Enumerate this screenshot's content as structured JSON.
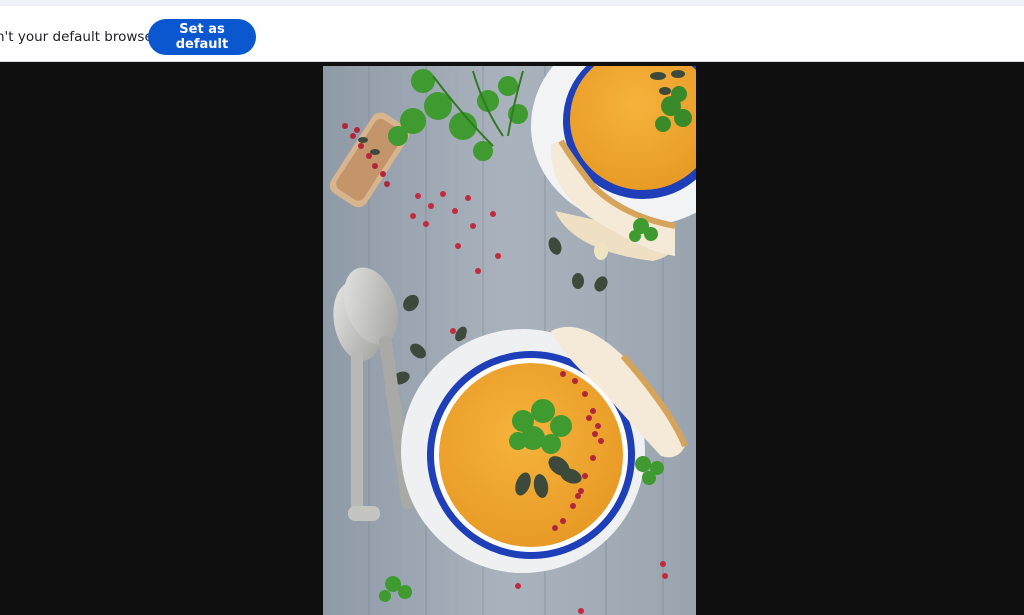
{
  "infobar": {
    "message": "n't your default browser",
    "button_label": "Set as default"
  },
  "viewer": {
    "image_subject": "soup-bowls-photo"
  },
  "colors": {
    "button": "#0b57d0",
    "background": "#0f0f10",
    "infobar": "#ffffff"
  }
}
